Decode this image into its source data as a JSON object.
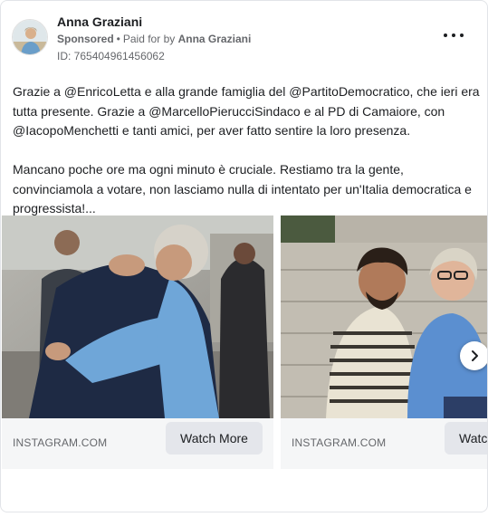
{
  "post": {
    "author_name": "Anna Graziani",
    "sponsored_label": "Sponsored",
    "paid_for_prefix": "Paid for by",
    "paid_for_name": "Anna Graziani",
    "ad_id": "ID: 765404961456062",
    "more_icon": "more-horizontal-icon",
    "paragraphs": [
      "Grazie a @EnricoLetta e alla grande famiglia del @PartitoDemocratico, che ieri era tutta presente. Grazie a @MarcelloPierucciSindaco e al PD di Camaiore, con @IacopoMenchetti e tanti amici, per aver fatto sentire la loro presenza.",
      "Mancano poche ore ma ogni minuto è cruciale. Restiamo tra la gente, convinciamola a votare, non lasciamo nulla di intentato per un'Italia democratica e progressista!..."
    ]
  },
  "carousel": {
    "cards": [
      {
        "domain": "INSTAGRAM.COM",
        "cta_label": "Watch More"
      },
      {
        "domain": "INSTAGRAM.COM",
        "cta_label": "Watch More"
      }
    ],
    "next_icon": "chevron-right-icon"
  },
  "colors": {
    "text_primary": "#1c1e21",
    "text_secondary": "#65676b",
    "button_bg": "#e4e6eb",
    "caption_bg": "#f5f6f7"
  }
}
